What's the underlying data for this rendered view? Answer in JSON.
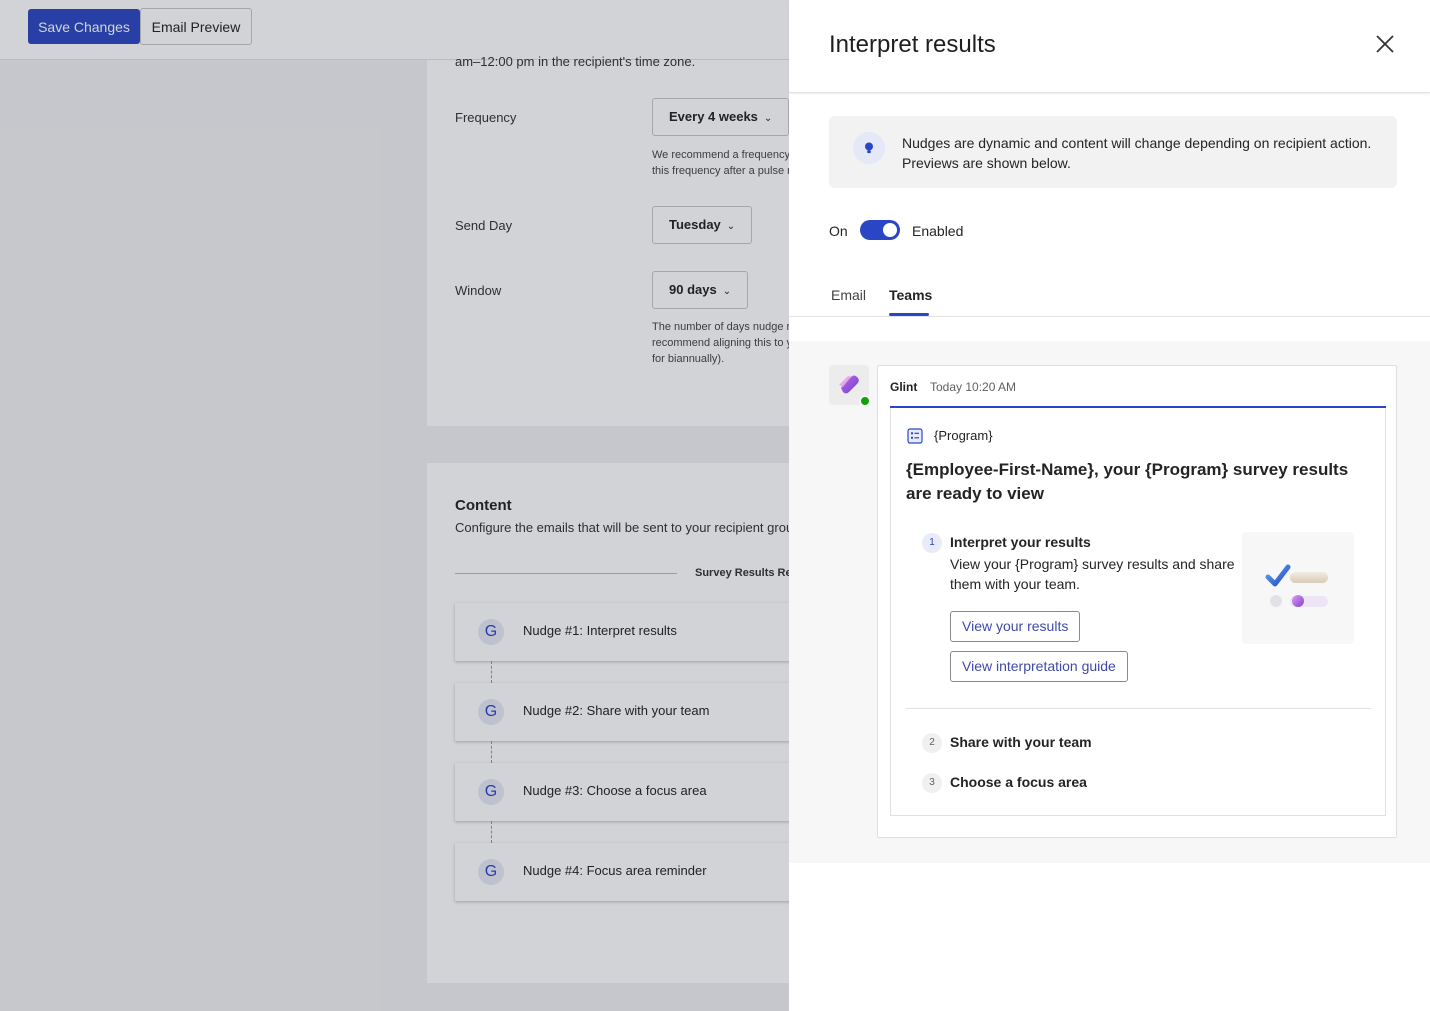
{
  "toolbar": {
    "save_label": "Save Changes",
    "preview_label": "Email Preview"
  },
  "settings": {
    "cut_text": "am–12:00 pm in the recipient's time zone.",
    "frequency_label": "Frequency",
    "frequency_value": "Every 4 weeks",
    "frequency_help_1": "We recommend a frequency",
    "frequency_help_2": "this frequency after a pulse re",
    "sendday_label": "Send Day",
    "sendday_value": "Tuesday",
    "window_label": "Window",
    "window_value": "90 days",
    "window_help_1": "The number of days nudge m",
    "window_help_2": "recommend aligning this to y",
    "window_help_3": "for biannually)."
  },
  "content": {
    "title": "Content",
    "description": "Configure the emails that will be sent to your recipient group",
    "divider_label": "Survey Results Rele",
    "nudges": [
      {
        "label": "Nudge #1: Interpret results",
        "icon": "G"
      },
      {
        "label": "Nudge #2: Share with your team",
        "icon": "G"
      },
      {
        "label": "Nudge #3: Choose a focus area",
        "icon": "G"
      },
      {
        "label": "Nudge #4: Focus area reminder",
        "icon": "G"
      }
    ]
  },
  "panel": {
    "title": "Interpret results",
    "info_text": "Nudges are dynamic and content will change depending on recipient action. Previews are shown below.",
    "toggle_on": "On",
    "toggle_state": "Enabled",
    "tabs": [
      {
        "label": "Email",
        "active": false
      },
      {
        "label": "Teams",
        "active": true
      }
    ],
    "message": {
      "sender": "Glint",
      "time": "Today 10:20 AM",
      "program": "{Program}",
      "headline": "{Employee-First-Name}, your {Program} survey results are ready to view",
      "steps": [
        {
          "number": "1",
          "title": "Interpret your results",
          "description": "View your {Program} survey results and share them with your team.",
          "buttons": [
            "View your results",
            "View interpretation guide"
          ]
        },
        {
          "number": "2",
          "title": "Share with your team"
        },
        {
          "number": "3",
          "title": "Choose a focus area"
        }
      ]
    }
  },
  "colors": {
    "primary": "#2b46c4",
    "status_online": "#13a10e",
    "link_button": "#3f4aa8"
  }
}
